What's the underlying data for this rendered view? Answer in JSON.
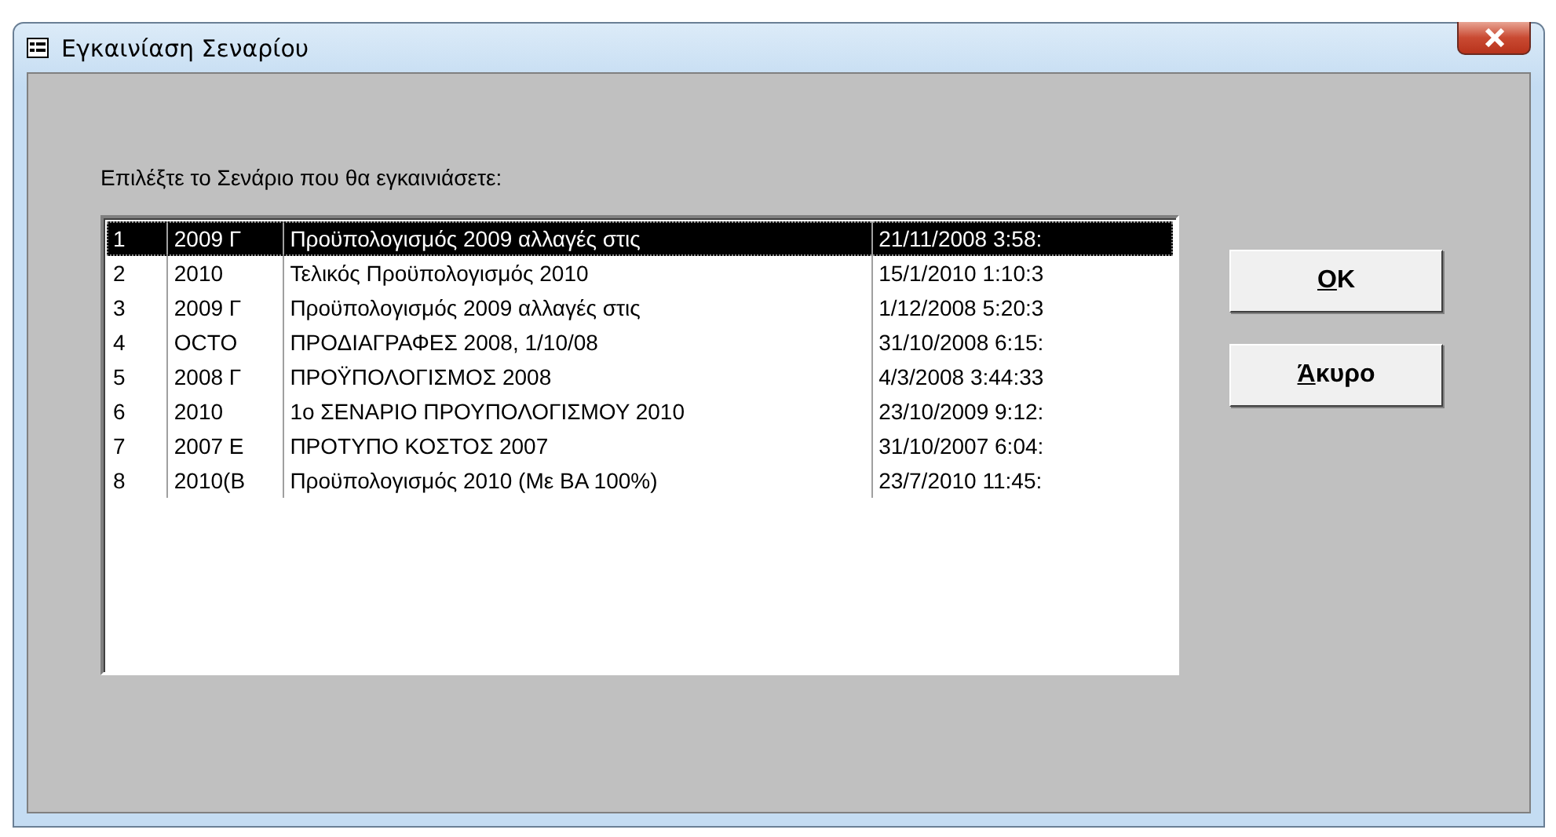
{
  "window": {
    "title": "Εγκαινίαση Σεναρίου"
  },
  "prompt": "Επιλέξτε το Σενάριο που θα εγκαινιάσετε:",
  "list": {
    "rows": [
      {
        "cells": [
          "1",
          "2009 Γ",
          "Προϋπολογισμός 2009 αλλαγές στις",
          "21/11/2008 3:58:"
        ],
        "selected": true
      },
      {
        "cells": [
          "2",
          "2010",
          "Τελικός Προϋπολογισμός 2010",
          "15/1/2010 1:10:3"
        ],
        "selected": false
      },
      {
        "cells": [
          "3",
          "2009 Γ",
          "Προϋπολογισμός 2009 αλλαγές στις",
          "1/12/2008 5:20:3"
        ],
        "selected": false
      },
      {
        "cells": [
          "4",
          "OCTO",
          "ΠΡΟΔΙΑΓΡΑΦΕΣ 2008, 1/10/08",
          "31/10/2008 6:15:"
        ],
        "selected": false
      },
      {
        "cells": [
          "5",
          "2008 Γ",
          "ΠΡΟΫΠΟΛΟΓΙΣΜΟΣ 2008",
          "4/3/2008 3:44:33"
        ],
        "selected": false
      },
      {
        "cells": [
          "6",
          "2010",
          "1ο ΣΕΝΑΡΙΟ ΠΡΟΥΠΟΛΟΓΙΣΜΟΥ 2010",
          "23/10/2009 9:12:"
        ],
        "selected": false
      },
      {
        "cells": [
          "7",
          "2007 Ε",
          "ΠΡΟΤΥΠΟ ΚΟΣΤΟΣ 2007",
          "31/10/2007 6:04:"
        ],
        "selected": false
      },
      {
        "cells": [
          "8",
          "2010(B",
          "Προϋπολογισμός 2010 (Με ΒΑ 100%)",
          "23/7/2010 11:45:"
        ],
        "selected": false
      }
    ]
  },
  "buttons": [
    {
      "label": "OK",
      "mnemonic_underlined": true
    },
    {
      "label": "Άκυρο",
      "mnemonic_underlined": true
    }
  ]
}
